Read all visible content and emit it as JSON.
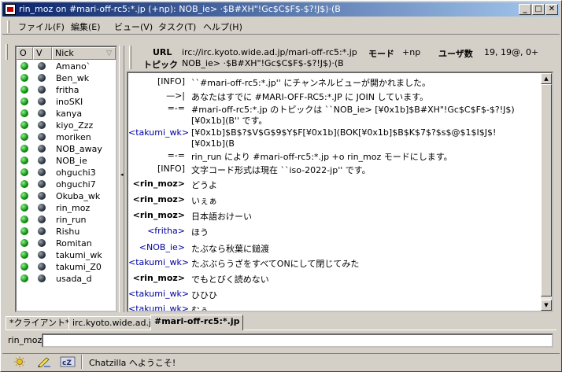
{
  "window": {
    "title": "rin_moz on #mari-off-rc5:*.jp (+np): NOB_ie> ·$B#XH\"!Gc$C$F$-$?!J$)·(B",
    "minimize": "_",
    "maximize": "□",
    "close": "✕"
  },
  "menu": [
    {
      "label": "ファイル(F)"
    },
    {
      "label": "編集(E)"
    },
    {
      "label": "ビュー(V)"
    },
    {
      "label": "タスク(T)"
    },
    {
      "label": "ヘルプ(H)"
    }
  ],
  "userlist": {
    "col_op": "O",
    "col_voice": "V",
    "col_nick": "Nick",
    "sort_icon": "▽",
    "users": [
      "Amano`",
      "Ben_wk",
      "fritha",
      "inoSKI",
      "kanya",
      "kiyo_Zzz",
      "moriken",
      "NOB_away",
      "NOB_ie",
      "ohguchi3",
      "ohguchi7",
      "Okuba_wk",
      "rin_moz",
      "rin_run",
      "Rishu",
      "Romitan",
      "takumi_wk",
      "takumi_Z0",
      "usada_d"
    ]
  },
  "channel_header": {
    "url_label": "URL",
    "url_value": "irc://irc.kyoto.wide.ad.jp/mari-off-rc5:*.jp",
    "mode_label": "モード",
    "mode_value": "+np",
    "users_label": "ユーザ数",
    "users_value": "19, 19@, 0+",
    "topic_label": "トピック",
    "topic_value": "NOB_ie> ·$B#XH\"!Gc$C$F$-$?!J$)·(B"
  },
  "messages": [
    {
      "nick": "[INFO]",
      "text": "``#mari-off-rc5:*.jp'' にチャンネルビューが開かれました。"
    },
    {
      "nick": "—>|",
      "text": "あなたはすでに #MARI-OFF-RC5:*.JP に JOIN しています。"
    },
    {
      "nick": "=-=",
      "text": "#mari-off-rc5:*.jp のトピックは ``NOB_ie> [¥0x1b]$B#XH\"!Gc$C$F$-$?!J$)"
    },
    {
      "nick": "",
      "text": "[¥0x1b](B'' です。"
    },
    {
      "nick": "<takumi_wk>",
      "text": "[¥0x1b]$B$?$V$G$9$Y$F[¥0x1b](BOK[¥0x1b]$B$K$7$?$s$@$1$I$J$!"
    },
    {
      "nick": "",
      "text": "[¥0x1b](B"
    },
    {
      "nick": "=-=",
      "text": "rin_run により #mari-off-rc5:*.jp +o rin_moz  モードにします。"
    },
    {
      "nick": "[INFO]",
      "text": "文字コード形式は現在 ``iso-2022-jp'' です。"
    },
    {
      "nick": "<rin_moz>",
      "text": "どうよ"
    },
    {
      "nick": "<rin_moz>",
      "text": "いぇぁ"
    },
    {
      "nick": "<rin_moz>",
      "text": "日本語おけーい"
    },
    {
      "nick": "<fritha>",
      "text": "ほう"
    },
    {
      "nick": "<NOB_ie>",
      "text": "たぶなら秋葉に鎚渡"
    },
    {
      "nick": "<takumi_wk>",
      "text": "たぶぶらうざをすべてONにして閉じてみた"
    },
    {
      "nick": "<rin_moz>",
      "text": "でもとびく読めない"
    },
    {
      "nick": "<takumi_wk>",
      "text": "ひひひ"
    },
    {
      "nick": "<takumi_wk>",
      "text": "むぅ"
    }
  ],
  "tabs": [
    {
      "label": "*クライアント*"
    },
    {
      "label": "irc.kyoto.wide.ad.jp"
    },
    {
      "label": "#mari-off-rc5:*.jp"
    }
  ],
  "input": {
    "nick": "rin_moz",
    "value": ""
  },
  "status": {
    "text": "Chatzilla へようこそ!"
  }
}
